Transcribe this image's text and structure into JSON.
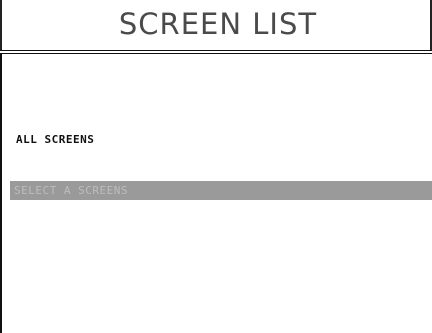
{
  "header": {
    "title": "SCREEN LIST"
  },
  "list": {
    "items": [
      {
        "label": "ALL SCREENS",
        "state": "normal"
      },
      {
        "label": "SELECT A SCREENS",
        "state": "highlighted"
      }
    ]
  }
}
